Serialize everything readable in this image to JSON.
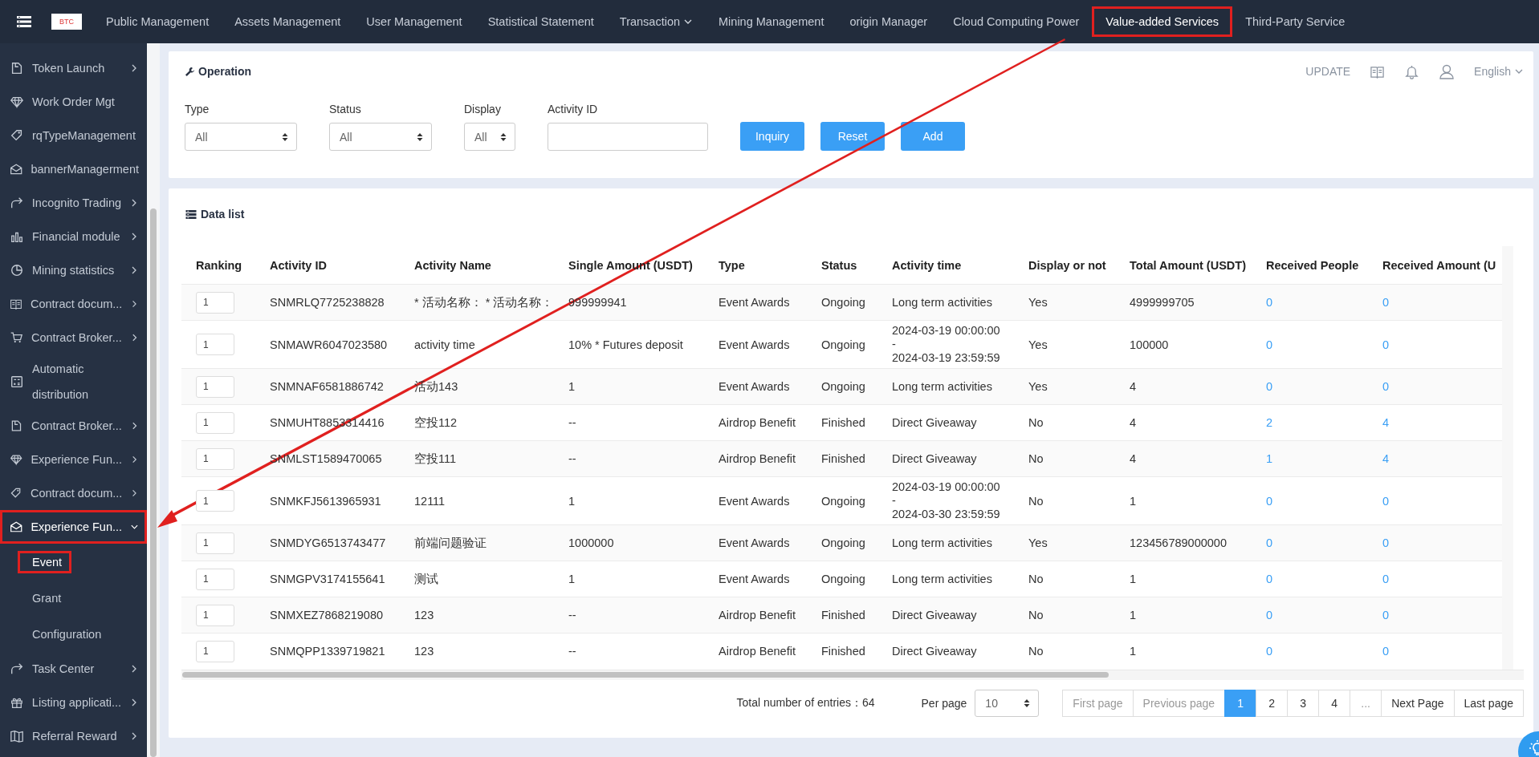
{
  "top_nav": {
    "logo_text": "BTC",
    "items": [
      {
        "label": "Public Management",
        "kind": "link",
        "selected": false,
        "highlighted": false
      },
      {
        "label": "Assets Management",
        "kind": "link",
        "selected": false,
        "highlighted": false
      },
      {
        "label": "User Management",
        "kind": "link",
        "selected": false,
        "highlighted": false
      },
      {
        "label": "Statistical Statement",
        "kind": "link",
        "selected": false,
        "highlighted": false
      },
      {
        "label": "Transaction",
        "kind": "dropdown",
        "selected": false,
        "highlighted": false
      },
      {
        "label": "Mining Management",
        "kind": "link",
        "selected": false,
        "highlighted": false
      },
      {
        "label": "origin Manager",
        "kind": "link",
        "selected": false,
        "highlighted": false
      },
      {
        "label": "Cloud Computing Power",
        "kind": "link",
        "selected": false,
        "highlighted": false
      },
      {
        "label": "Value-added Services",
        "kind": "link",
        "selected": true,
        "highlighted": true
      },
      {
        "label": "Third-Party Service",
        "kind": "link",
        "selected": false,
        "highlighted": false
      }
    ]
  },
  "header_tools": {
    "update": "UPDATE",
    "language": "English"
  },
  "sidebar": {
    "items": [
      {
        "label": "Token Launch",
        "kind": "group",
        "expanded": false,
        "highlighted": false
      },
      {
        "label": "Work Order Mgt",
        "kind": "link",
        "highlighted": false
      },
      {
        "label": "rqTypeManagement",
        "kind": "link",
        "highlighted": false
      },
      {
        "label": "bannerManagerment",
        "kind": "link",
        "highlighted": false
      },
      {
        "label": "Incognito Trading",
        "kind": "group",
        "expanded": false,
        "highlighted": false
      },
      {
        "label": "Financial module",
        "kind": "group",
        "expanded": false,
        "highlighted": false
      },
      {
        "label": "Mining statistics",
        "kind": "group",
        "expanded": false,
        "highlighted": false
      },
      {
        "label": "Contract docum...",
        "kind": "group",
        "expanded": false,
        "highlighted": false
      },
      {
        "label": "Contract Broker...",
        "kind": "group",
        "expanded": false,
        "highlighted": false
      },
      {
        "label": "Automatic distribution",
        "kind": "link",
        "highlighted": false
      },
      {
        "label": "Contract Broker...",
        "kind": "group",
        "expanded": false,
        "highlighted": false
      },
      {
        "label": "Experience Fun...",
        "kind": "group",
        "expanded": false,
        "highlighted": false
      },
      {
        "label": "Contract docum...",
        "kind": "group",
        "expanded": false,
        "highlighted": false
      },
      {
        "label": "Experience Fun...",
        "kind": "group",
        "expanded": true,
        "highlighted": true,
        "children": [
          {
            "label": "Event",
            "selected": true,
            "highlighted": true
          },
          {
            "label": "Grant",
            "selected": false,
            "highlighted": false
          },
          {
            "label": "Configuration",
            "selected": false,
            "highlighted": false
          }
        ]
      },
      {
        "label": "Task Center",
        "kind": "group",
        "expanded": false,
        "highlighted": false
      },
      {
        "label": "Listing applicati...",
        "kind": "group",
        "expanded": false,
        "highlighted": false
      },
      {
        "label": "Referral Reward",
        "kind": "group",
        "expanded": false,
        "highlighted": false
      }
    ]
  },
  "operation": {
    "title": "Operation",
    "filters": [
      {
        "kind": "select",
        "label": "Type",
        "value": "All"
      },
      {
        "kind": "select",
        "label": "Status",
        "value": "All"
      },
      {
        "kind": "select",
        "label": "Display",
        "value": "All"
      },
      {
        "kind": "input",
        "label": "Activity ID"
      }
    ],
    "buttons": [
      "Inquiry",
      "Reset",
      "Add"
    ]
  },
  "data_list": {
    "title": "Data list",
    "columns": [
      "Ranking",
      "Activity ID",
      "Activity Name",
      "Single Amount (USDT)",
      "Type",
      "Status",
      "Activity time",
      "Display or not",
      "Total Amount (USDT)",
      "Received People",
      "Received Amount (U"
    ],
    "rows": [
      {
        "ranking": "1",
        "activity_id": "SNMRLQ7725238828",
        "activity_name": "* 活动名称： * 活动名称：",
        "single_amount": "999999941",
        "type": "Event Awards",
        "status": "Ongoing",
        "activity_time": [
          "Long term activities"
        ],
        "display": "Yes",
        "total_amount": "4999999705",
        "received_people": "0",
        "received_amount": "0"
      },
      {
        "ranking": "1",
        "activity_id": "SNMAWR6047023580",
        "activity_name": "activity time",
        "single_amount": "10% * Futures deposit",
        "type": "Event Awards",
        "status": "Ongoing",
        "activity_time": [
          "2024-03-19 00:00:00",
          "-",
          "2024-03-19 23:59:59"
        ],
        "display": "Yes",
        "total_amount": "100000",
        "received_people": "0",
        "received_amount": "0"
      },
      {
        "ranking": "1",
        "activity_id": "SNMNAF6581886742",
        "activity_name": "活动143",
        "single_amount": "1",
        "type": "Event Awards",
        "status": "Ongoing",
        "activity_time": [
          "Long term activities"
        ],
        "display": "Yes",
        "total_amount": "4",
        "received_people": "0",
        "received_amount": "0"
      },
      {
        "ranking": "1",
        "activity_id": "SNMUHT8853314416",
        "activity_name": "空投112",
        "single_amount": "--",
        "type": "Airdrop Benefit",
        "status": "Finished",
        "activity_time": [
          "Direct Giveaway"
        ],
        "display": "No",
        "total_amount": "4",
        "received_people": "2",
        "received_amount": "4"
      },
      {
        "ranking": "1",
        "activity_id": "SNMLST1589470065",
        "activity_name": "空投111",
        "single_amount": "--",
        "type": "Airdrop Benefit",
        "status": "Finished",
        "activity_time": [
          "Direct Giveaway"
        ],
        "display": "No",
        "total_amount": "4",
        "received_people": "1",
        "received_amount": "4"
      },
      {
        "ranking": "1",
        "activity_id": "SNMKFJ5613965931",
        "activity_name": "12111",
        "single_amount": "1",
        "type": "Event Awards",
        "status": "Ongoing",
        "activity_time": [
          "2024-03-19 00:00:00",
          "-",
          "2024-03-30 23:59:59"
        ],
        "display": "No",
        "total_amount": "1",
        "received_people": "0",
        "received_amount": "0"
      },
      {
        "ranking": "1",
        "activity_id": "SNMDYG6513743477",
        "activity_name": "前端问题验证",
        "single_amount": "1000000",
        "type": "Event Awards",
        "status": "Ongoing",
        "activity_time": [
          "Long term activities"
        ],
        "display": "Yes",
        "total_amount": "123456789000000",
        "received_people": "0",
        "received_amount": "0"
      },
      {
        "ranking": "1",
        "activity_id": "SNMGPV3174155641",
        "activity_name": "测试",
        "single_amount": "1",
        "type": "Event Awards",
        "status": "Ongoing",
        "activity_time": [
          "Long term activities"
        ],
        "display": "No",
        "total_amount": "1",
        "received_people": "0",
        "received_amount": "0"
      },
      {
        "ranking": "1",
        "activity_id": "SNMXEZ7868219080",
        "activity_name": "123",
        "single_amount": "--",
        "type": "Airdrop Benefit",
        "status": "Finished",
        "activity_time": [
          "Direct Giveaway"
        ],
        "display": "No",
        "total_amount": "1",
        "received_people": "0",
        "received_amount": "0"
      },
      {
        "ranking": "1",
        "activity_id": "SNMQPP1339719821",
        "activity_name": "123",
        "single_amount": "--",
        "type": "Airdrop Benefit",
        "status": "Finished",
        "activity_time": [
          "Direct Giveaway"
        ],
        "display": "No",
        "total_amount": "1",
        "received_people": "0",
        "received_amount": "0"
      }
    ]
  },
  "pagination": {
    "total": "Total number of entries：64",
    "per_page_label": "Per page",
    "per_page": "10",
    "pages": [
      {
        "label": "First page",
        "kind": "nav",
        "selected": false,
        "disabled": true
      },
      {
        "label": "Previous page",
        "kind": "nav",
        "selected": false,
        "disabled": true
      },
      {
        "label": "1",
        "kind": "page",
        "selected": true,
        "disabled": false
      },
      {
        "label": "2",
        "kind": "page",
        "selected": false,
        "disabled": false
      },
      {
        "label": "3",
        "kind": "page",
        "selected": false,
        "disabled": false
      },
      {
        "label": "4",
        "kind": "page",
        "selected": false,
        "disabled": false
      },
      {
        "label": "...",
        "kind": "ellipsis",
        "selected": false,
        "disabled": true
      },
      {
        "label": "Next Page",
        "kind": "nav",
        "selected": false,
        "disabled": false
      },
      {
        "label": "Last page",
        "kind": "nav",
        "selected": false,
        "disabled": false
      }
    ]
  }
}
